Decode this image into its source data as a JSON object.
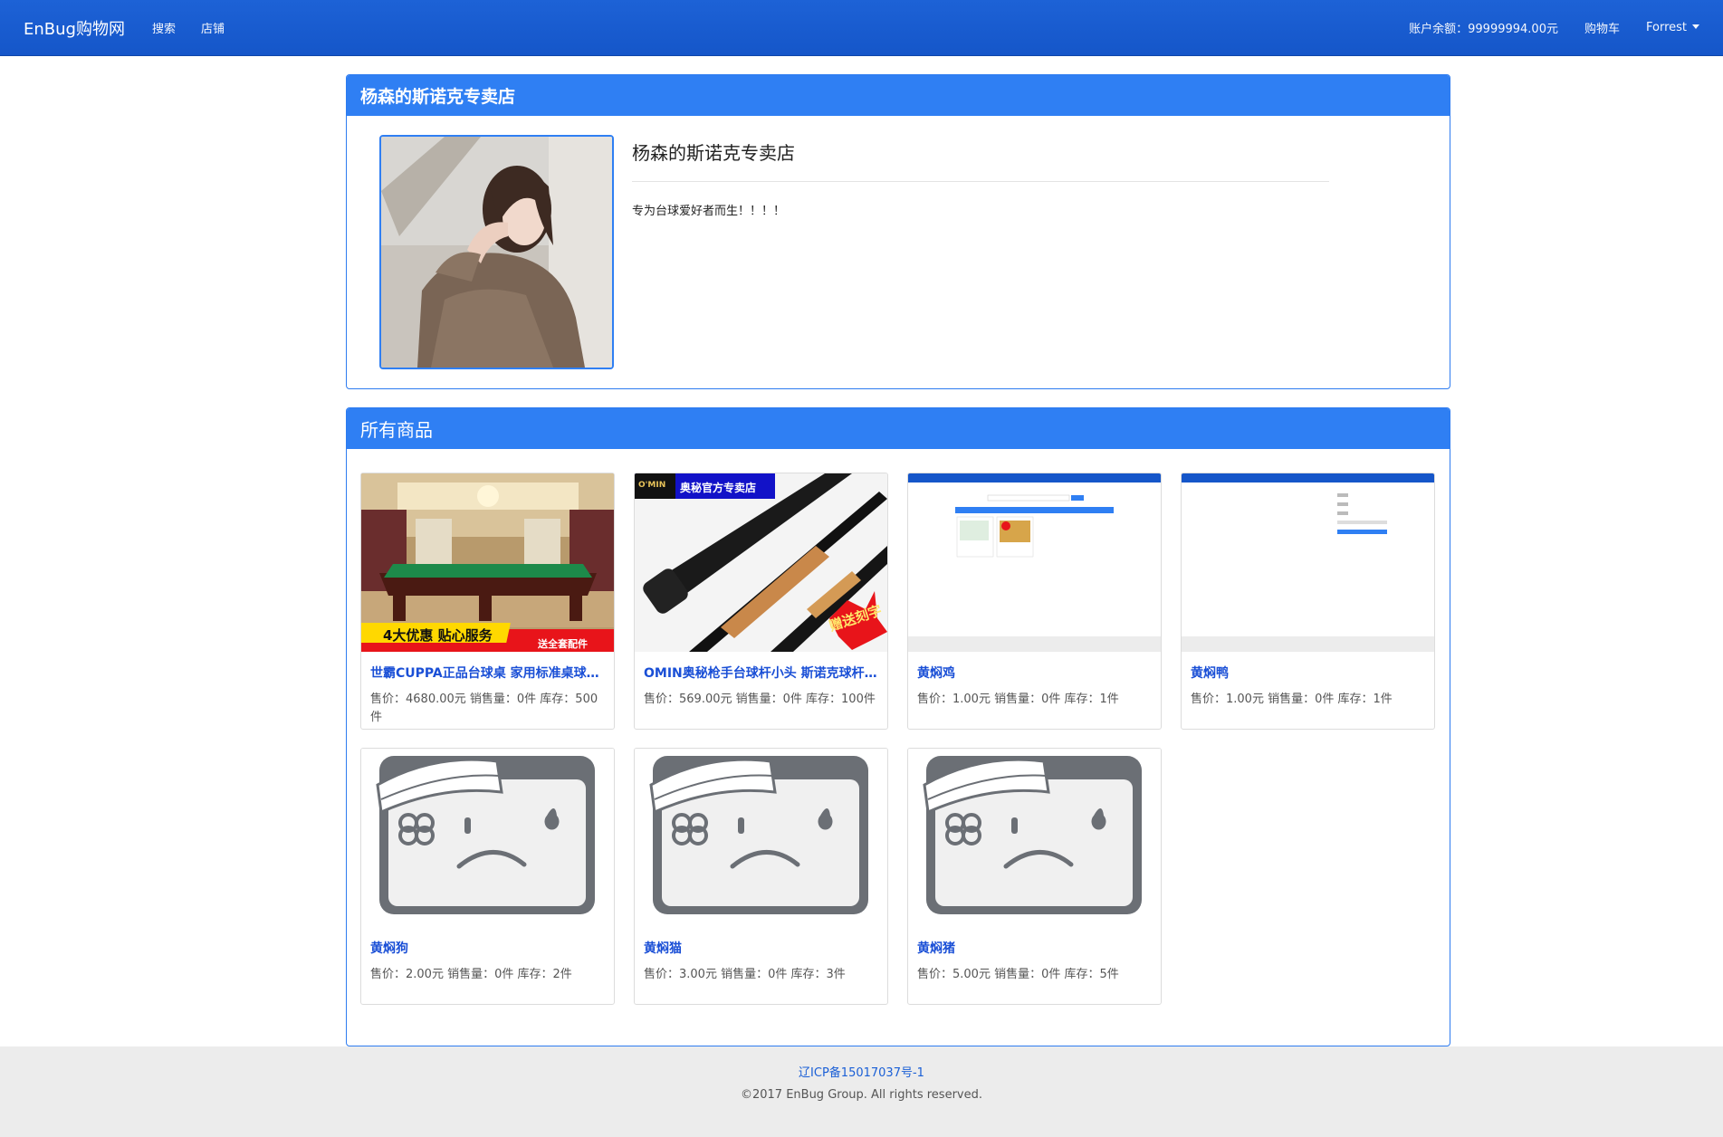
{
  "navbar": {
    "brand": "EnBug购物网",
    "links": [
      "搜索",
      "店铺"
    ],
    "balance": "账户余额：99999994.00元",
    "cart": "购物车",
    "user": "Forrest"
  },
  "shop": {
    "heading": "杨森的斯诺克专卖店",
    "name": "杨森的斯诺克专卖店",
    "description": "专为台球爱好者而生！！！！",
    "avatar_icon": "portrait-photo"
  },
  "goods": {
    "heading": "所有商品",
    "items": [
      {
        "title": "世霸CUPPA正品台球桌 家用标准桌球台成人美式黑八台球桌",
        "info": "售价：4680.00元  销售量：0件  库存：500件",
        "image": "billiard-table-photo",
        "banner": "4大优惠 贴心服务",
        "banner2": "送全套配件"
      },
      {
        "title": "OMIN奥秘枪手台球杆小头 斯诺克球杆 黑八",
        "info": "售价：569.00元  销售量：0件  库存：100件",
        "image": "cue-stick-photo",
        "logo": "O'MIN",
        "tag": "奥秘官方专卖店",
        "badge": "赠送刻字"
      },
      {
        "title": "黄焖鸡",
        "info": "售价：1.00元  销售量：0件  库存：1件",
        "image": "screenshot-thumbnail"
      },
      {
        "title": "黄焖鸭",
        "info": "售价：1.00元  销售量：0件  库存：1件",
        "image": "screenshot-thumbnail"
      },
      {
        "title": "黄焖狗",
        "info": "售价：2.00元  销售量：0件  库存：2件",
        "image": "broken-image-placeholder"
      },
      {
        "title": "黄焖猫",
        "info": "售价：3.00元  销售量：0件  库存：3件",
        "image": "broken-image-placeholder"
      },
      {
        "title": "黄焖猪",
        "info": "售价：5.00元  销售量：0件  库存：5件",
        "image": "broken-image-placeholder"
      }
    ]
  },
  "footer": {
    "icp": "辽ICP备15017037号-1",
    "copyright": "©2017 EnBug Group. All rights reserved."
  },
  "colors": {
    "navbar": "#1556c9",
    "panel_heading": "#2f7ff3",
    "link": "#1a4fd6",
    "footer_bg": "#ececec"
  }
}
